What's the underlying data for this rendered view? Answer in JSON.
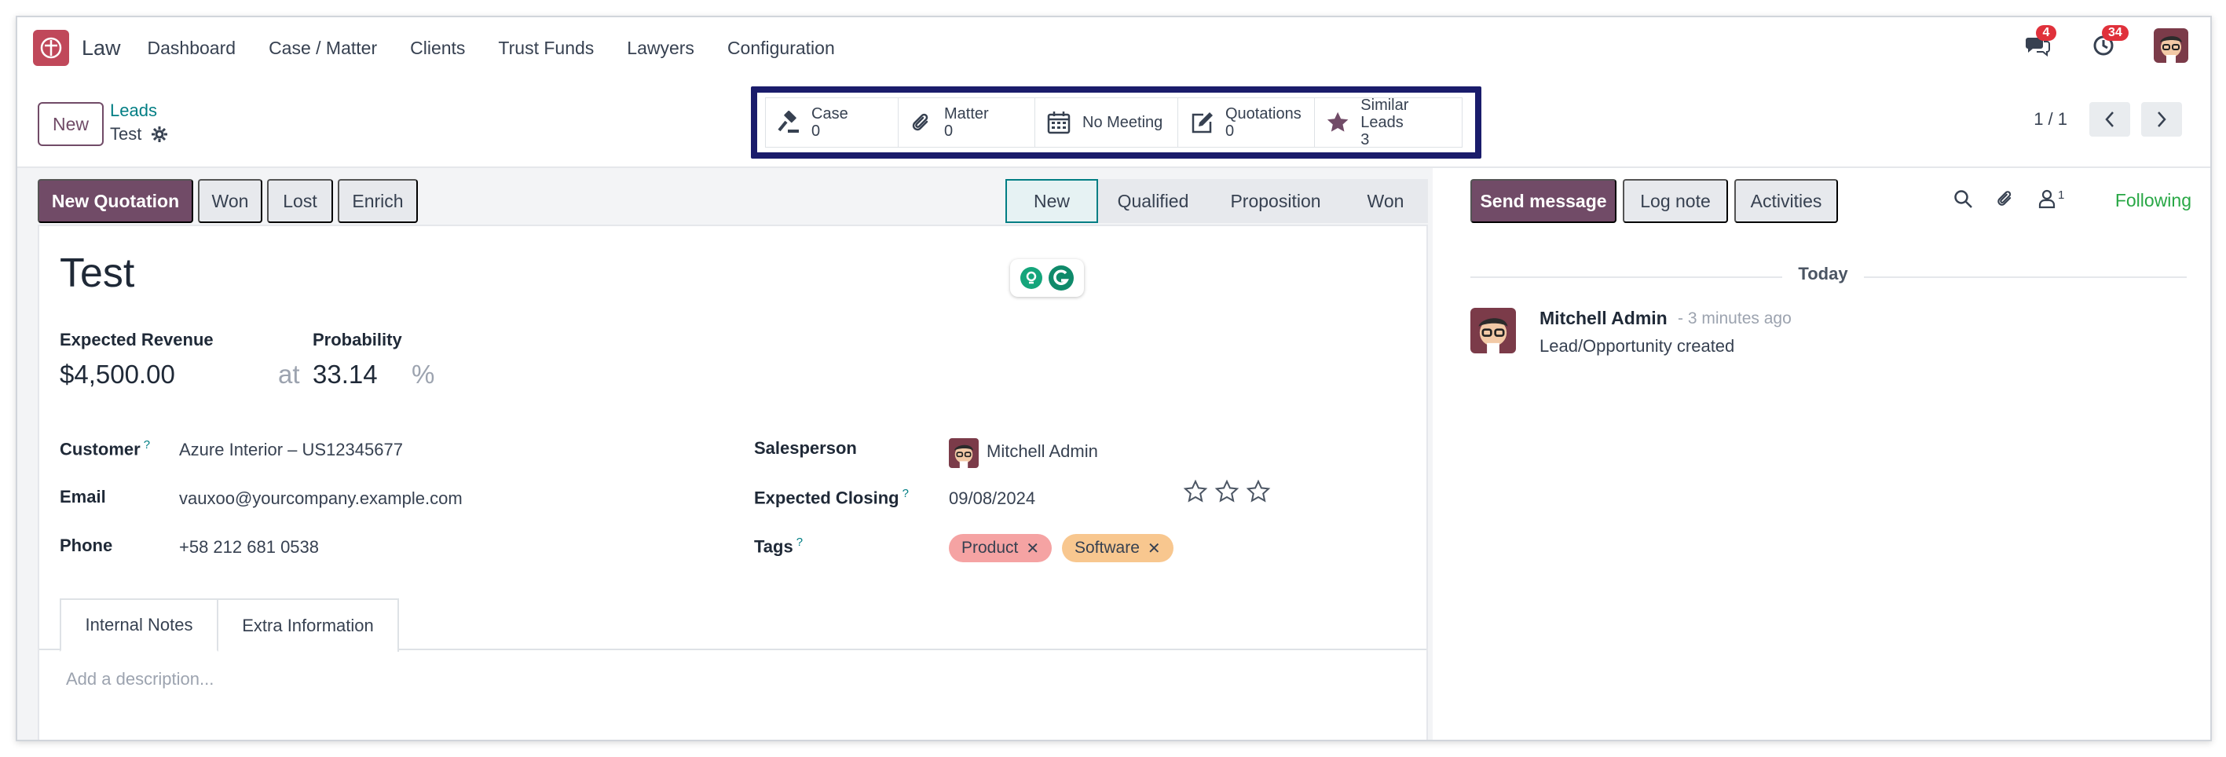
{
  "navbar": {
    "app_name": "Law",
    "menu": [
      "Dashboard",
      "Case / Matter",
      "Clients",
      "Trust Funds",
      "Lawyers",
      "Configuration"
    ],
    "messages_badge": "4",
    "activities_badge": "34"
  },
  "control": {
    "new_label": "New",
    "breadcrumb_parent": "Leads",
    "breadcrumb_current": "Test",
    "smart_buttons": [
      {
        "label": "Case",
        "value": "0",
        "icon": "gavel-icon"
      },
      {
        "label": "Matter",
        "value": "0",
        "icon": "paperclip-icon"
      },
      {
        "label": "No Meeting",
        "value": "",
        "icon": "calendar-icon"
      },
      {
        "label": "Quotations",
        "value": "0",
        "icon": "edit-icon"
      },
      {
        "label": "Similar Leads",
        "value": "3",
        "icon": "star-icon"
      }
    ],
    "pager": "1 / 1"
  },
  "status": {
    "actions": [
      "New Quotation",
      "Won",
      "Lost",
      "Enrich"
    ],
    "stages": [
      "New",
      "Qualified",
      "Proposition",
      "Won"
    ],
    "active_stage": "New"
  },
  "form": {
    "title": "Test",
    "expected_revenue_label": "Expected Revenue",
    "expected_revenue": "$4,500.00",
    "at": "at",
    "probability_label": "Probability",
    "probability": "33.14",
    "percent": "%",
    "customer_label": "Customer",
    "customer": "Azure Interior – US12345677",
    "email_label": "Email",
    "email": "vauxoo@yourcompany.example.com",
    "phone_label": "Phone",
    "phone": "+58 212 681 0538",
    "salesperson_label": "Salesperson",
    "salesperson": "Mitchell Admin",
    "expected_closing_label": "Expected Closing",
    "expected_closing": "09/08/2024",
    "priority_stars": 0,
    "tags_label": "Tags",
    "tags": [
      {
        "label": "Product",
        "color": "#f5a3a3"
      },
      {
        "label": "Software",
        "color": "#f8c78f"
      }
    ],
    "help_mark": "?",
    "tabs": [
      "Internal Notes",
      "Extra Information"
    ],
    "description_placeholder": "Add a description..."
  },
  "chatter": {
    "send_message": "Send message",
    "log_note": "Log note",
    "activities": "Activities",
    "followers_count": "1",
    "following": "Following",
    "date_separator": "Today",
    "message_author": "Mitchell Admin",
    "message_time": "- 3 minutes ago",
    "message_body": "Lead/Opportunity created"
  },
  "colors": {
    "primary": "#714b67",
    "link": "#017e84",
    "following": "#28a745",
    "badge": "#e0313b",
    "smart_box_highlight": "#1a1c6b"
  }
}
